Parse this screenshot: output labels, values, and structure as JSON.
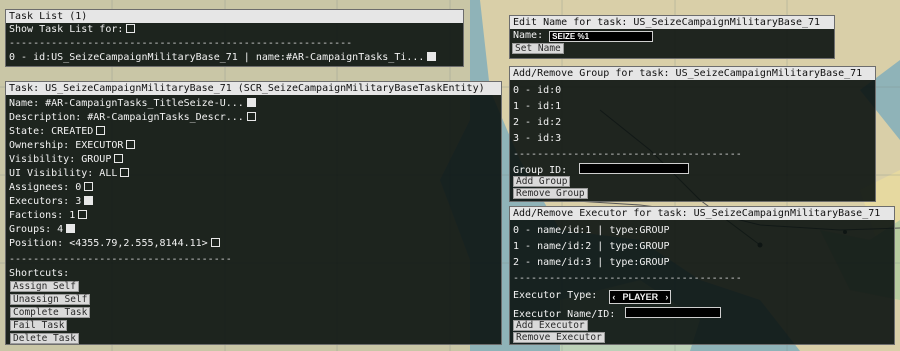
{
  "task_list": {
    "title": "Task List (1)",
    "show_label": "Show Task List for:",
    "separator": "---------------------------------------------------------",
    "item": "0 - id:US_SeizeCampaignMilitaryBase_71 | name:#AR-CampaignTasks_Ti..."
  },
  "task_detail": {
    "title": "Task: US_SeizeCampaignMilitaryBase_71 (SCR_SeizeCampaignMilitaryBaseTaskEntity)",
    "fields": {
      "name": "Name: #AR-CampaignTasks_TitleSeize-U...",
      "description": "Description: #AR-CampaignTasks_Descr...",
      "state": "State: CREATED",
      "ownership": "Ownership: EXECUTOR",
      "visibility": "Visibility: GROUP",
      "ui_visibility": "UI Visibility: ALL",
      "assignees": "Assignees: 0",
      "executors": "Executors: 3",
      "factions": "Factions: 1",
      "groups": "Groups: 4",
      "position": "Position: <4355.79,2.555,8144.11>"
    },
    "separator": "-------------------------------------",
    "shortcuts_label": "Shortcuts:",
    "buttons": {
      "assign_self": "Assign Self",
      "unassign_self": "Unassign Self",
      "complete_task": "Complete Task",
      "fail_task": "Fail Task",
      "delete_task": "Delete Task"
    }
  },
  "edit_name": {
    "title": "Edit Name for task: US_SeizeCampaignMilitaryBase_71",
    "name_label": "Name:",
    "name_value": "SEIZE %1",
    "set_name_button": "Set Name"
  },
  "group_panel": {
    "title": "Add/Remove Group for task: US_SeizeCampaignMilitaryBase_71",
    "items": [
      "0 - id:0",
      "1 - id:1",
      "2 - id:2",
      "3 - id:3"
    ],
    "separator": "--------------------------------------",
    "group_id_label": "Group ID:",
    "group_id_value": "",
    "add_button": "Add Group",
    "remove_button": "Remove Group"
  },
  "executor_panel": {
    "title": "Add/Remove Executor for task: US_SeizeCampaignMilitaryBase_71",
    "items": [
      "0 - name/id:1 | type:GROUP",
      "1 - name/id:2 | type:GROUP",
      "2 - name/id:3 | type:GROUP"
    ],
    "separator": "--------------------------------------",
    "executor_type_label": "Executor Type:",
    "executor_type_value": "PLAYER",
    "executor_name_label": "Executor Name/ID:",
    "executor_name_value": "",
    "add_button": "Add Executor",
    "remove_button": "Remove Executor"
  },
  "colors": {
    "panel_bg": "#0a1210",
    "title_bg": "#e6e6e6",
    "map_water": "#8fb3b8",
    "map_land": "#d9cfa8"
  }
}
